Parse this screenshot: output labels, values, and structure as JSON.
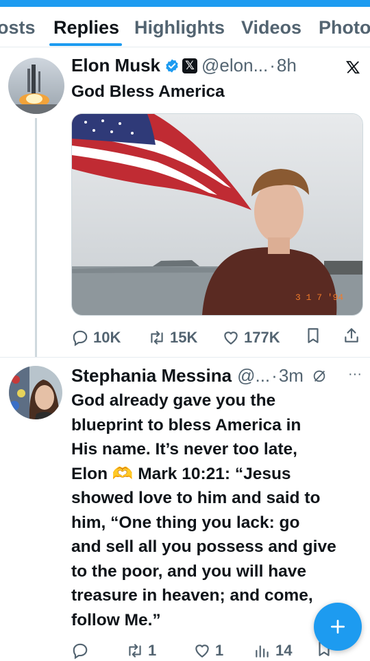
{
  "tabs": [
    {
      "label": "osts"
    },
    {
      "label": "Replies"
    },
    {
      "label": "Highlights"
    },
    {
      "label": "Videos"
    },
    {
      "label": "Photo"
    }
  ],
  "active_tab": "Replies",
  "tweet": {
    "author_name": "Elon Musk",
    "handle": "@elon...",
    "separator": "·",
    "time": "8h",
    "text": "God Bless America",
    "photo_date_stamp": "3 1  7 '94",
    "stats": {
      "replies": "10K",
      "retweets": "15K",
      "likes": "177K"
    }
  },
  "reply": {
    "author_name": "Stephania Messina",
    "handle": "@...",
    "separator": "·",
    "time": "3m",
    "text_lines": [
      "God already gave you the",
      "blueprint to bless America in",
      "His name. It’s never too late,",
      "Elon 🫶 Mark 10:21: “Jesus",
      "showed love to him and said to",
      "him, “One thing you lack: go",
      "and sell all you possess and give",
      "to the poor, and you will have",
      "treasure in heaven; and come,",
      "follow Me.”"
    ],
    "stats": {
      "retweets": "1",
      "likes": "1",
      "views": "14"
    },
    "more_label": "···"
  },
  "colors": {
    "accent": "#1d9bf0",
    "text": "#0f1419",
    "muted": "#536471"
  }
}
